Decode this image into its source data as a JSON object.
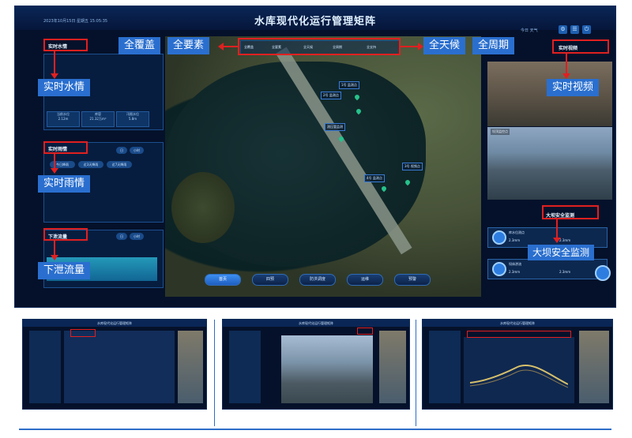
{
  "header": {
    "title": "水库现代化运行管理矩阵",
    "datetime": "2023年10月15日  星期五  15:05:35",
    "version": "今日 天气",
    "icon_labels": [
      "⚙",
      "☰",
      "⏻"
    ]
  },
  "callouts": {
    "realtime_water": "实时水情",
    "realtime_rain": "实时雨情",
    "discharge_flow": "下泄流量",
    "full_coverage": "全覆盖",
    "all_elements": "全要素",
    "all_weather": "全天候",
    "full_cycle": "全周期",
    "realtime_video": "实时视频",
    "dam_safety_monitoring": "大坝安全监测"
  },
  "panels": {
    "water_regime": {
      "header": "实时水情",
      "stats": [
        "当前水位",
        "库容",
        "汛限水位"
      ],
      "values": [
        "2.12m",
        "21.32万m³",
        "5.8m"
      ]
    },
    "rain_regime": {
      "header": "实时雨情",
      "pills": [
        "今日降雨",
        "近3天降雨",
        "近7天降雨"
      ],
      "toggle": [
        "日",
        "小时"
      ]
    },
    "discharge": {
      "header": "下泄流量",
      "toggle": [
        "日",
        "小时"
      ]
    },
    "video": {
      "header": "实时视频",
      "cams": [
        "大坝左岸",
        "坝顶监控点"
      ]
    },
    "safety": {
      "header": "大坝安全监测",
      "rows": [
        {
          "label": "库水位测点",
          "value1": "2.3mm",
          "value2": "2.3mm"
        },
        {
          "label": "坝体渗流",
          "value1": "2.3mm",
          "value2": "2.3mm"
        }
      ]
    }
  },
  "top_tabs": [
    "全覆盖",
    "全要素",
    "全天候",
    "全周期",
    "全支持"
  ],
  "map_labels": [
    "1号 监测点",
    "2号 监测点",
    "测压管监测",
    "3号 视频点",
    "4号 监测点"
  ],
  "bottom_nav": [
    "首页",
    "四预",
    "防洪调度",
    "运维",
    "预警"
  ],
  "bottom_nav_active": 0,
  "thumbnails": [
    {
      "title": "水库现代化运行管理矩阵"
    },
    {
      "title": "水库现代化运行管理矩阵"
    },
    {
      "title": "水库现代化运行管理矩阵"
    }
  ],
  "colors": {
    "accent": "#2a6fcf",
    "highlight": "#e02020",
    "bg": "#05112a"
  }
}
